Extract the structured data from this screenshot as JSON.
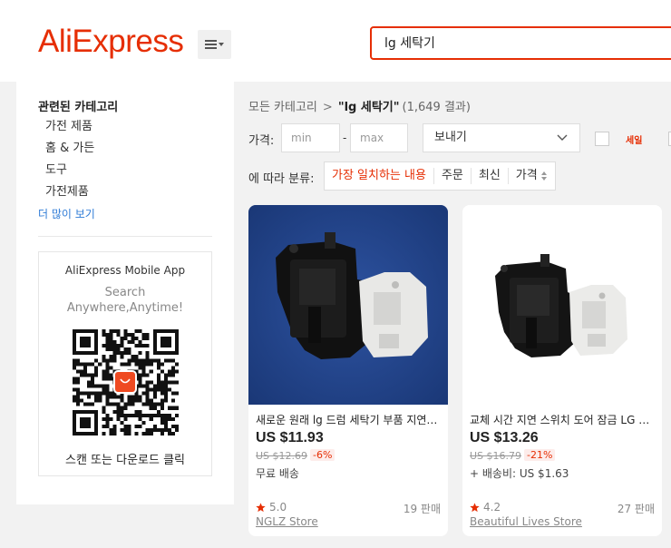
{
  "header": {
    "logo_text": "AliExpress",
    "menu_icon": "hamburger-menu-icon",
    "search_value": "lg 세탁기"
  },
  "sidebar": {
    "title": "관련된 카테고리",
    "categories": [
      "가전 제품",
      "홈 & 가든",
      "도구",
      "가전제품"
    ],
    "more_label": "더 많이 보기",
    "app_promo": {
      "title": "AliExpress Mobile App",
      "subtitle_line1": "Search",
      "subtitle_line2": "Anywhere,Anytime!",
      "qr_logo_text": "AliExpress",
      "scan_label": "스캔 또는 다운로드 클릭"
    }
  },
  "breadcrumb": {
    "root": "모든 카테고리",
    "separator": ">",
    "query": "\"lg 세탁기\"",
    "count": "(1,649 결과)"
  },
  "filters": {
    "price_label": "가격:",
    "min_placeholder": "min",
    "dash": "-",
    "max_placeholder": "max",
    "ship_select": "보내기",
    "sale_label": "세일"
  },
  "sort": {
    "label": "에 따라 분류:",
    "options": [
      "가장 일치하는 내용",
      "주문",
      "최신",
      "가격"
    ],
    "active": "가장 일치하는 내용"
  },
  "products": [
    {
      "title": "새로운 원래 lg 드럼 세탁기 부품 지연 스위치 도어 잠금",
      "price": "US $11.93",
      "original_price": "US $12.69",
      "discount": "-6%",
      "shipping": "무료 배송",
      "rating": "5.0",
      "sold": "19 판매",
      "store": "NGLZ Store",
      "image_bg": "#1f3f86"
    },
    {
      "title": "교체 시간 지연 스위치 도어 잠금 LG 세탁기",
      "price": "US $13.26",
      "original_price": "US $16.79",
      "discount": "-21%",
      "shipping": "+ 배송비: US $1.63",
      "rating": "4.2",
      "sold": "27 판매",
      "store": "Beautiful Lives Store",
      "image_bg": "#ffffff"
    }
  ],
  "colors": {
    "brand": "#e62e04",
    "link": "#2e7bd6",
    "star": "#e62e04"
  }
}
